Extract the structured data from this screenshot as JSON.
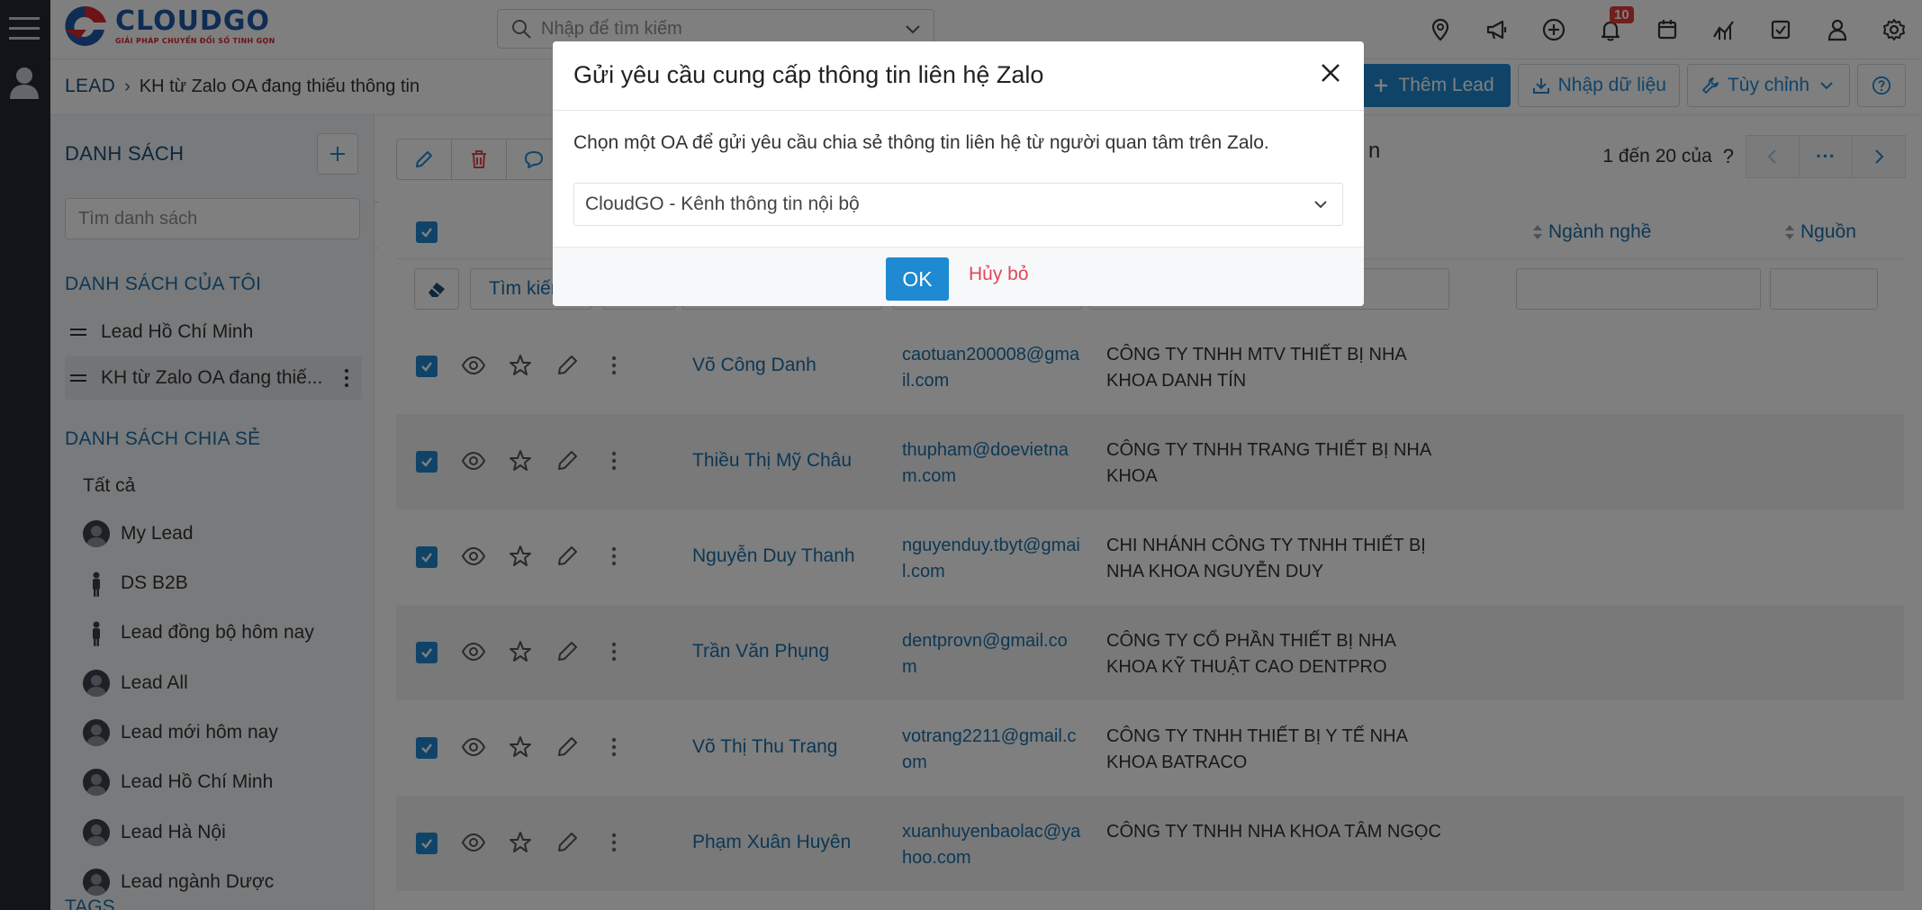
{
  "header": {
    "logo_name": "CLOUDGO",
    "logo_slogan": "GIẢI PHÁP CHUYỂN ĐỔI SỐ TINH GỌN",
    "search_placeholder": "Nhập để tìm kiếm",
    "notification_count": "10"
  },
  "breadcrumb": {
    "root": "LEAD",
    "separator": "›",
    "current": "KH từ Zalo OA đang thiếu thông tin"
  },
  "actions": {
    "add_lead": "Thêm Lead",
    "import": "Nhập dữ liệu",
    "customize": "Tùy chỉnh"
  },
  "sidebar": {
    "title": "DANH SÁCH",
    "search_placeholder": "Tìm danh sách",
    "my_lists_title": "DANH SÁCH CỦA TÔI",
    "my_lists": [
      {
        "label": "Lead Hồ Chí Minh"
      },
      {
        "label": "KH từ Zalo OA đang thiế..."
      }
    ],
    "shared_title": "DANH SÁCH CHIA SẺ",
    "shared_all": "Tất cả",
    "shared": [
      {
        "label": "My Lead"
      },
      {
        "label": "DS B2B"
      },
      {
        "label": "Lead đồng bộ hôm nay"
      },
      {
        "label": "Lead All"
      },
      {
        "label": "Lead mới hôm nay"
      },
      {
        "label": "Lead Hồ Chí Minh"
      },
      {
        "label": "Lead Hà Nội"
      },
      {
        "label": "Lead ngành Dược"
      }
    ],
    "tags_title": "TAGS"
  },
  "list": {
    "toolbar_obscured_text": "n",
    "pager_text": "1 đến 20 của",
    "pager_unknown": "?",
    "pager_more": "···",
    "columns": {
      "industry": "Ngành nghề",
      "source": "Nguồn"
    },
    "filter_search_label": "Tìm kiếm",
    "rows": [
      {
        "name": "Võ Công Danh",
        "email": "caotuan200008@gmail.com",
        "company": "CÔNG TY TNHH MTV THIẾT BỊ NHA KHOA DANH TÍN"
      },
      {
        "name": "Thiều Thị Mỹ Châu",
        "email": "thupham@doevietnam.com",
        "company": "CÔNG TY TNHH TRANG THIẾT BỊ NHA KHOA"
      },
      {
        "name": "Nguyễn Duy Thanh",
        "email": "nguyenduy.tbyt@gmail.com",
        "company": "CHI NHÁNH CÔNG TY TNHH THIẾT BỊ NHA KHOA NGUYỄN DUY"
      },
      {
        "name": "Trần Văn Phụng",
        "email": "dentprovn@gmail.com",
        "company": "CÔNG TY CỔ PHẦN THIẾT BỊ NHA KHOA KỸ THUẬT CAO DENTPRO"
      },
      {
        "name": "Võ Thị Thu Trang",
        "email": "votrang2211@gmail.com",
        "company": "CÔNG TY TNHH THIẾT BỊ Y TẾ NHA KHOA BATRACO"
      },
      {
        "name": "Phạm Xuân Huyên",
        "email": "xuanhuyenbaolac@yahoo.com",
        "company": "CÔNG TY TNHH NHA KHOA TÂM NGỌC"
      }
    ]
  },
  "modal": {
    "title": "Gửi yêu cầu cung cấp thông tin liên hệ Zalo",
    "description": "Chọn một OA để gửi yêu cầu chia sẻ thông tin liên hệ từ người quan tâm trên Zalo.",
    "selected_oa": "CloudGO - Kênh thông tin nội bộ",
    "ok_label": "OK",
    "cancel_label": "Hủy bỏ"
  },
  "colors": {
    "primary": "#1f89d1",
    "link": "#1a6fa8",
    "rail": "#222b34",
    "danger": "#e2475b",
    "badge": "#e23c3c"
  }
}
